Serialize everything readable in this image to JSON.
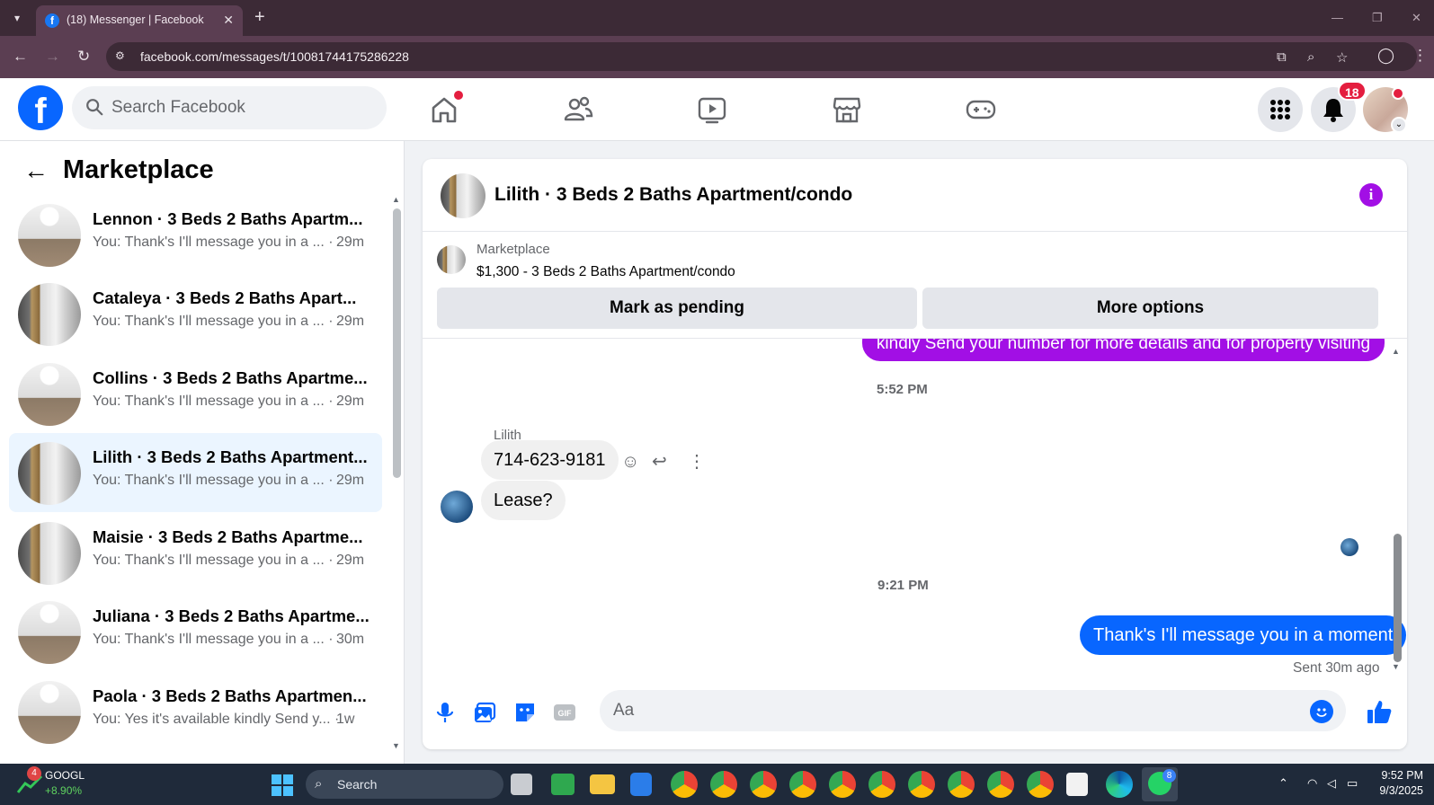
{
  "browser": {
    "tab_title": "(18) Messenger | Facebook",
    "url": "facebook.com/messages/t/10081744175286228"
  },
  "header": {
    "search_placeholder": "Search Facebook",
    "notification_count": "18"
  },
  "sidebar": {
    "title": "Marketplace",
    "conversations": [
      {
        "name": "Lennon · 3 Beds 2 Baths Apartm...",
        "snippet": "You: Thank's I'll message you in a ... ·",
        "time": "29m",
        "thumb": "room"
      },
      {
        "name": "Cataleya · 3 Beds 2 Baths Apart...",
        "snippet": "You: Thank's I'll message you in a ... ·",
        "time": "29m",
        "thumb": "closet"
      },
      {
        "name": "Collins · 3 Beds 2 Baths Apartme...",
        "snippet": "You: Thank's I'll message you in a ... ·",
        "time": "29m",
        "thumb": "room"
      },
      {
        "name": "Lilith · 3 Beds 2 Baths Apartment...",
        "snippet": "You: Thank's I'll message you in a ... ·",
        "time": "29m",
        "thumb": "closet"
      },
      {
        "name": "Maisie · 3 Beds 2 Baths Apartme...",
        "snippet": "You: Thank's I'll message you in a ... ·",
        "time": "29m",
        "thumb": "closet"
      },
      {
        "name": "Juliana · 3 Beds 2 Baths Apartme...",
        "snippet": "You: Thank's I'll message you in a ... ·",
        "time": "30m",
        "thumb": "room"
      },
      {
        "name": "Paola · 3 Beds 2 Baths Apartmen...",
        "snippet": "You: Yes it's available kindly Send y... ·",
        "time": "1w",
        "thumb": "room"
      }
    ]
  },
  "chat": {
    "title": "Lilith · 3 Beds 2 Baths Apartment/condo",
    "marketplace_label": "Marketplace",
    "listing": "$1,300 - 3 Beds 2 Baths Apartment/condo",
    "mark_pending_label": "Mark as pending",
    "more_options_label": "More options",
    "prev_outgoing": "kindly Send your number for more details and for property visiting",
    "timestamp_1": "5:52 PM",
    "sender_name": "Lilith",
    "msg_phone": "714-623-9181",
    "msg_lease": "Lease?",
    "timestamp_2": "9:21 PM",
    "msg_out": "Thank's I'll message you in a moment",
    "sent_note": "Sent 30m ago",
    "composer_placeholder": "Aa"
  },
  "taskbar": {
    "stock_ticker": "GOOGL",
    "stock_change": "+8.90%",
    "stock_badge": "4",
    "search_label": "Search",
    "time": "9:52 PM",
    "date": "9/3/2025",
    "whatsapp_badge": "8"
  },
  "colors": {
    "fb_blue": "#0866ff",
    "accent_purple": "#a20fe5",
    "notif_red": "#e41e3f"
  }
}
